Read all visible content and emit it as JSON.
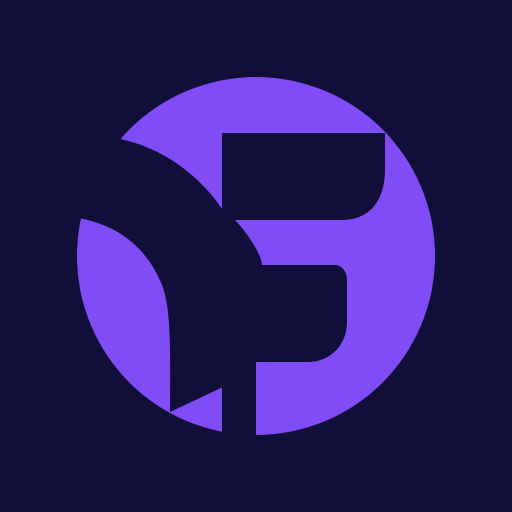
{
  "logo": {
    "icon": "abstract-purple-circle-logo",
    "background_color": "#110e3a",
    "accent_color": "#7f4cf5",
    "cutout_color": "#110e3a"
  }
}
